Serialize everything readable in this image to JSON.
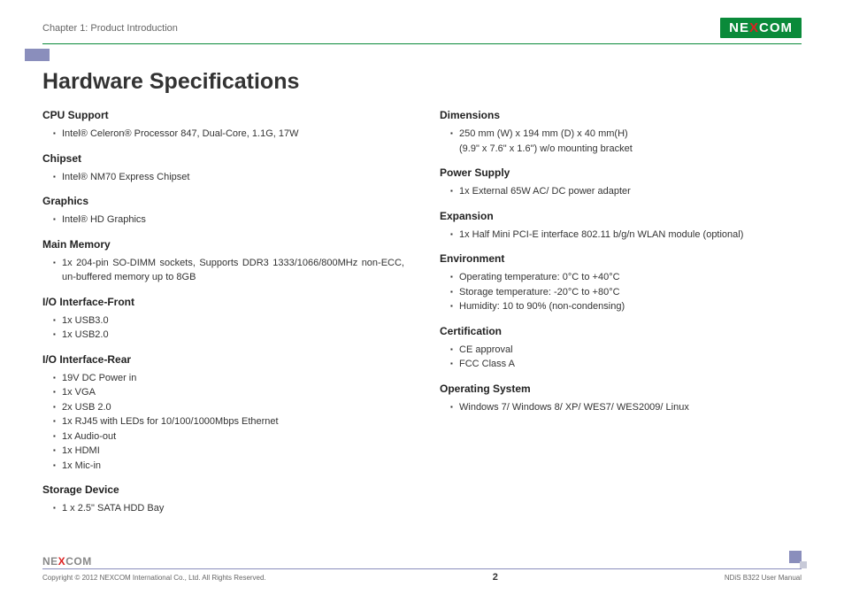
{
  "header": {
    "chapter": "Chapter 1: Product Introduction",
    "logo_pre": "NE",
    "logo_x": "X",
    "logo_post": "COM"
  },
  "title": "Hardware Specifications",
  "left": {
    "s1": {
      "h": "CPU Support",
      "items": [
        "Intel® Celeron® Processor 847, Dual-Core, 1.1G, 17W"
      ]
    },
    "s2": {
      "h": "Chipset",
      "items": [
        "Intel® NM70 Express Chipset"
      ]
    },
    "s3": {
      "h": "Graphics",
      "items": [
        "Intel® HD Graphics"
      ]
    },
    "s4": {
      "h": "Main Memory",
      "items": [
        "1x 204-pin SO-DIMM sockets, Supports DDR3 1333/1066/800MHz non-ECC, un-buffered memory up to 8GB"
      ]
    },
    "s5": {
      "h": "I/O Interface-Front",
      "items": [
        "1x USB3.0",
        "1x USB2.0"
      ]
    },
    "s6": {
      "h": "I/O Interface-Rear",
      "items": [
        "19V DC Power in",
        "1x VGA",
        "2x USB 2.0",
        "1x RJ45 with LEDs for 10/100/1000Mbps Ethernet",
        "1x Audio-out",
        "1x HDMI",
        "1x Mic-in"
      ]
    },
    "s7": {
      "h": "Storage Device",
      "items": [
        "1 x 2.5\" SATA HDD Bay"
      ]
    }
  },
  "right": {
    "s1": {
      "h": "Dimensions",
      "items": [
        "250 mm (W) x 194 mm (D) x 40 mm(H)\n(9.9\" x 7.6\" x 1.6\") w/o mounting bracket"
      ]
    },
    "s2": {
      "h": "Power Supply",
      "items": [
        "1x External 65W AC/ DC power adapter"
      ]
    },
    "s3": {
      "h": "Expansion",
      "items": [
        "1x Half Mini PCI-E interface 802.11 b/g/n WLAN module (optional)"
      ]
    },
    "s4": {
      "h": "Environment",
      "items": [
        "Operating temperature: 0°C to +40°C",
        "Storage temperature: -20°C to +80°C",
        "Humidity: 10 to 90% (non-condensing)"
      ]
    },
    "s5": {
      "h": "Certification",
      "items": [
        "CE approval",
        "FCC Class A"
      ]
    },
    "s6": {
      "h": "Operating System",
      "items": [
        "Windows 7/ Windows 8/ XP/ WES7/ WES2009/ Linux"
      ]
    }
  },
  "footer": {
    "copyright": "Copyright © 2012 NEXCOM International Co., Ltd. All Rights Reserved.",
    "page": "2",
    "manual": "NDiS B322 User Manual"
  }
}
